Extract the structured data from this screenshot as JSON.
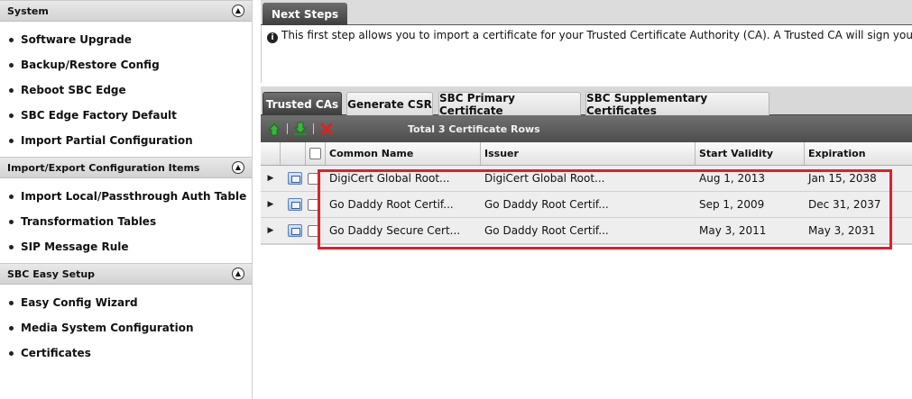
{
  "sidebar": {
    "sections": [
      {
        "title": "System",
        "items": [
          "Software Upgrade",
          "Backup/Restore Config",
          "Reboot SBC Edge",
          "SBC Edge Factory Default",
          "Import Partial Configuration"
        ]
      },
      {
        "title": "Import/Export Configuration Items",
        "items": [
          "Import Local/Passthrough Auth Table",
          "Transformation Tables",
          "SIP Message Rule"
        ]
      },
      {
        "title": "SBC Easy Setup",
        "items": [
          "Easy Config Wizard",
          "Media System Configuration",
          "Certificates"
        ]
      }
    ]
  },
  "next_steps": {
    "tab_label": "Next Steps",
    "message": "This first step allows you to import a certificate for your Trusted Certificate Authority (CA). A Trusted CA will sign your certificate"
  },
  "tabs": [
    "Trusted CAs",
    "Generate CSR",
    "SBC Primary Certificate",
    "SBC Supplementary Certificates"
  ],
  "active_tab": "Trusted CAs",
  "toolbar": {
    "total_label": "Total 3 Certificate Rows"
  },
  "table": {
    "columns": [
      "Common Name",
      "Issuer",
      "Start Validity",
      "Expiration"
    ],
    "rows": [
      {
        "common_name": "DigiCert Global Root...",
        "issuer": "DigiCert Global Root...",
        "start": "Aug 1, 2013",
        "expiration": "Jan 15, 2038"
      },
      {
        "common_name": "Go Daddy Root Certif...",
        "issuer": "Go Daddy Root Certif...",
        "start": "Sep 1, 2009",
        "expiration": "Dec 31, 2037"
      },
      {
        "common_name": "Go Daddy Secure Cert...",
        "issuer": "Go Daddy Root Certif...",
        "start": "May 3, 2011",
        "expiration": "May 3, 2031"
      }
    ]
  },
  "colors": {
    "highlight": "#e0202a",
    "active_tab": "#4a4a4a"
  }
}
